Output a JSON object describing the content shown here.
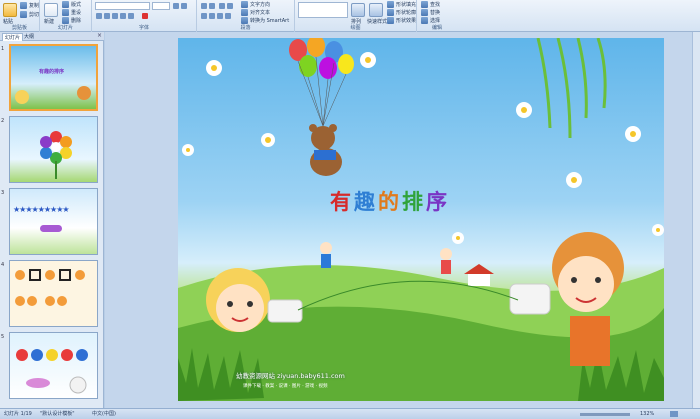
{
  "ribbon": {
    "clipboard": {
      "paste_label": "粘贴",
      "copy_label": "复制",
      "cut_label": "剪切",
      "group_label": "剪贴板"
    },
    "slides": {
      "new_label": "新建",
      "layout_label": "版式",
      "reset_label": "重设",
      "delete_label": "删除",
      "group_label": "幻灯片"
    },
    "font": {
      "group_label": "字体"
    },
    "paragraph": {
      "text_direction_label": "文字方向",
      "align_text_label": "对齐文本",
      "smartart_label": "转换为 SmartArt",
      "group_label": "段落"
    },
    "drawing": {
      "arrange_label": "排列",
      "quick_styles_label": "快速样式",
      "shape_fill_label": "形状填充",
      "shape_outline_label": "形状轮廓",
      "shape_effects_label": "形状效果",
      "group_label": "绘图"
    },
    "editing": {
      "find_label": "查找",
      "replace_label": "替换",
      "select_label": "选择",
      "group_label": "编辑"
    }
  },
  "panel": {
    "tab_slides": "幻灯片",
    "tab_outline": "大纲",
    "close": "×",
    "thumbnails": [
      {
        "number": "1",
        "caption": "有趣的排序"
      },
      {
        "number": "2",
        "caption": ""
      },
      {
        "number": "3",
        "caption": ""
      },
      {
        "number": "4",
        "caption": ""
      },
      {
        "number": "5",
        "caption": ""
      }
    ]
  },
  "slide": {
    "title_chars": [
      "有",
      "趣",
      "的",
      "排",
      "序"
    ],
    "title_colors": [
      "#d62b2b",
      "#2f7fd4",
      "#e07a1c",
      "#2fa33a",
      "#7a35c4"
    ],
    "footer": "幼教资源网站  ziyuan.baby611.com",
    "footer_small": "课件下载 · 教案 · 说课 · 图片 · 游戏 · 视频"
  },
  "statusbar": {
    "slide_info": "幻灯片 1/19",
    "theme": "\"默认设计模板\"",
    "language": "中文(中国)",
    "zoom": "132%"
  },
  "colors": {
    "accent": "#f1a33c",
    "ribbon_border": "#9db5d3"
  }
}
